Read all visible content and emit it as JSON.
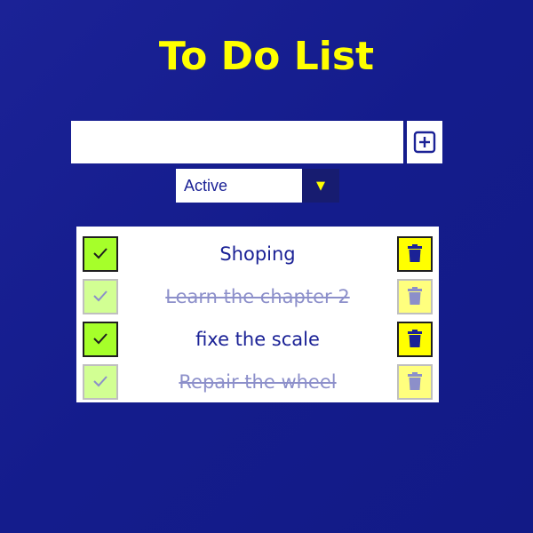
{
  "app": {
    "title": "To Do List"
  },
  "input": {
    "value": "",
    "placeholder": ""
  },
  "add_button": {
    "icon": "plus-square-icon"
  },
  "filter": {
    "selected": "Active",
    "caret_icon": "triangle-down-icon"
  },
  "todos": [
    {
      "text": "Shoping",
      "completed": false
    },
    {
      "text": "Learn the chapter 2",
      "completed": true
    },
    {
      "text": "fixe the scale",
      "completed": false
    },
    {
      "text": "Repair the wheel",
      "completed": true
    }
  ],
  "colors": {
    "background": "#1b2296",
    "accent": "#ffff00",
    "check": "#a6ff2a",
    "text": "#1b2296"
  }
}
